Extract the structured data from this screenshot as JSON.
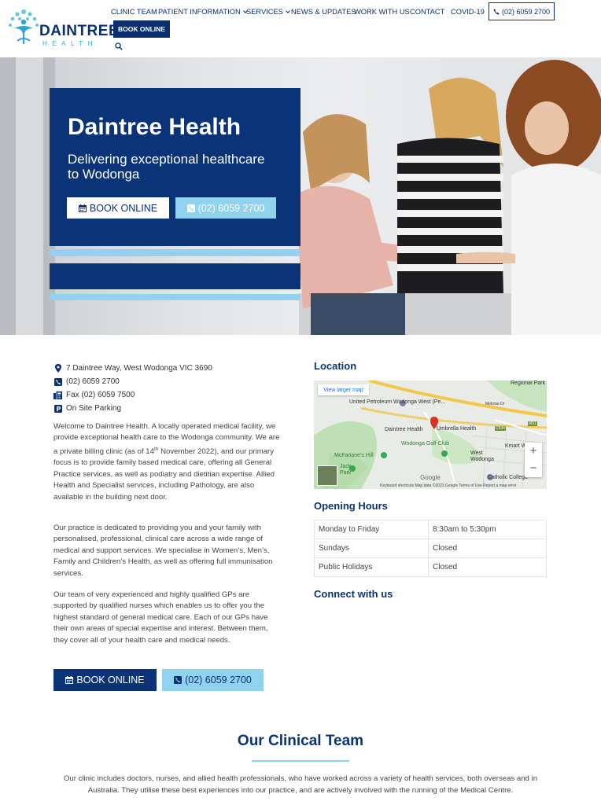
{
  "header": {
    "logo_text": "DAINTREE",
    "logo_sub": "HEALTH",
    "nav": [
      {
        "label": "CLINIC TEAM"
      },
      {
        "label": "PATIENT INFORMATION"
      },
      {
        "label": "SERVICES"
      },
      {
        "label": "NEWS & UPDATES"
      },
      {
        "label": "WORK WITH US"
      },
      {
        "label": "CONTACT"
      },
      {
        "label": "COVID-19"
      }
    ],
    "phone_label": "(02) 6059 2700",
    "book_label": "BOOK ONLINE",
    "search_icon": "search-icon"
  },
  "hero": {
    "title": "Daintree Health",
    "subtitle": "Delivering exceptional healthcare to Wodonga",
    "book_label": "BOOK ONLINE",
    "call_label": "(02) 6059 2700"
  },
  "contact": {
    "address": "7 Daintree Way, West Wodonga VIC 3690",
    "phone": "(02) 6059 2700",
    "fax": "Fax (02) 6059 7500",
    "parking": "On Site Parking"
  },
  "about": {
    "p1_a": "Welcome to Daintree Health. A locally operated medical facility, we provide exceptional health care to the Wodonga community. We are a private billing clinic (as of 14",
    "p1_sup": "th",
    "p1_b": " November 2022), and our primary focus is to provide family based medical care, offering all General Practice services, as well as podiatry and dietitian expertise. Allied Health and Specialist services, including Pathology, are also available in the building next door.",
    "p2": "Our practice is dedicated to providing you and your family with personalised, professional, clinical care across a wide range of medical and support services.  We specialise in Women’s, Men’s, Family and Children’s Health, as well as offering full immunisation services.",
    "p3": "Our team of very experienced and highly qualified GPs are supported by qualified nurses which enables us to offer you the highest standard of general medical care.  Each of our GPs have their own areas of special expertise and interest.  Between them, they cover all of your health care and medical needs.",
    "book_label": "BOOK ONLINE",
    "call_label": "(02) 6059 2700"
  },
  "location": {
    "heading": "Location",
    "view_larger": "View larger map",
    "labels": {
      "regional_park": "Regional Park",
      "petroleum": "United Petroleum Wodonga West (Pe...",
      "daintree": "Daintree Health",
      "umbrella": "Umbrella Health",
      "golf": "Wodonga Golf Club",
      "west_wodonga": "West Wodonga",
      "kmart": "Kmart W",
      "mcfarlanes": "McFarlane's Hill",
      "park": "Jack Park",
      "catholic": "Catholic College",
      "google": "Google",
      "road": "Melrose Dr",
      "route1": "C534",
      "route2": "M31"
    },
    "zoom_in": "+",
    "zoom_out": "−",
    "footer": "Keyboard shortcuts    Map data ©2023 Google    Terms of Use    Report a map error"
  },
  "hours": {
    "heading": "Opening Hours",
    "rows": [
      {
        "day": "Monday to Friday",
        "time": "8:30am to 5:30pm"
      },
      {
        "day": "Sundays",
        "time": "Closed"
      },
      {
        "day": "Public Holidays",
        "time": "Closed"
      }
    ]
  },
  "connect": {
    "heading": "Connect with us"
  },
  "team": {
    "title": "Our Clinical Team",
    "copy": "Our clinic includes doctors, nurses, and allied health professionals, who have worked across a variety of health services, both overseas and in Australia. They utilise these best experiences into our practice, and are actively involved with the running of the Medical Centre."
  },
  "colors": {
    "navy": "#0b3377",
    "light_blue": "#8fd3ef",
    "logo_teal": "#2aa6d6"
  }
}
